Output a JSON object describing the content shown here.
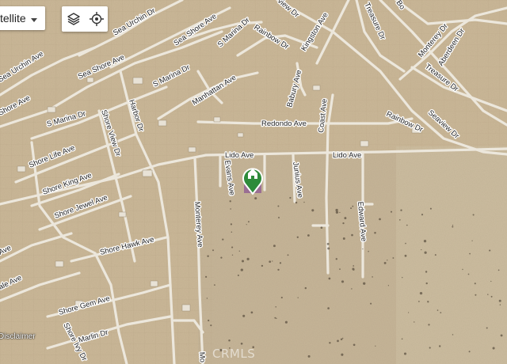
{
  "map_type": {
    "label": "tellite"
  },
  "controls": {
    "layers_icon": "layers-icon",
    "locate_icon": "crosshair-icon"
  },
  "footer": {
    "disclaimer": "Disclaimer",
    "watermark": "CRMLS"
  },
  "colors": {
    "terrain": "#cbb898",
    "desert": "#c6b598",
    "road": "#ede8de",
    "pin": "#2e8b3a",
    "listing": "#9a6e93"
  },
  "streets": {
    "sea_urchin_dr": "Sea Urchin Dr",
    "sea_urchin_ave": "Sea Urchin Ave",
    "sea_shore_ave_top": "Sea Shore Ave",
    "sea_shore_ave": "Sea Shore Ave",
    "s_marina_dr_top": "S Marina Dr",
    "s_marina_dr_mid": "S Marina Dr",
    "s_marina_dr_left": "S Marina Dr",
    "rainbow_dr_top": "Rainbow Dr",
    "rainbow_dr_right": "Rainbow Dr",
    "kingston_ave": "Kingston Ave",
    "treasure_dr_top": "Treasure Dr",
    "treasure_dr_right": "Treasure Dr",
    "monterey_dr": "Monterey Dr",
    "aberdeen_dr": "Aberdeen Dr",
    "seaview_dr": "Seaview Dr",
    "manhattan_ave": "Manhattan Ave",
    "babury_ave": "Babury Ave",
    "redondo_ave": "Redondo Ave",
    "coast_ave": "Coast Ave",
    "shore_ave": "Shore Ave",
    "shore_view_dr": "Shore View Dr",
    "harbor_dr": "Harbor Dr",
    "shore_life_ave": "Shore Life Ave",
    "lido_ave_left": "Lido Ave",
    "lido_ave_right": "Lido Ave",
    "evans_ave": "Evans Ave",
    "junius_ave": "Junius Ave",
    "edward_ave": "Edward Ave",
    "shore_king_ave": "Shore King Ave",
    "shore_jewel_ave": "Shore Jewel Ave",
    "monterey_ave": "Monterey Ave",
    "shore_hawk_ave": "Shore Hawk Ave",
    "shore_gem_ave": "Shore Gem Ave",
    "marlin_dr": "Marlin Dr",
    "shore_ivy_dr": "Shore Ivy Dr",
    "frag_left_1": "Ave",
    "frag_left_2": "ale Ave",
    "frag_bottom": "Mo",
    "frag_top_1": "view Dr",
    "frag_top_2": "Bo"
  }
}
